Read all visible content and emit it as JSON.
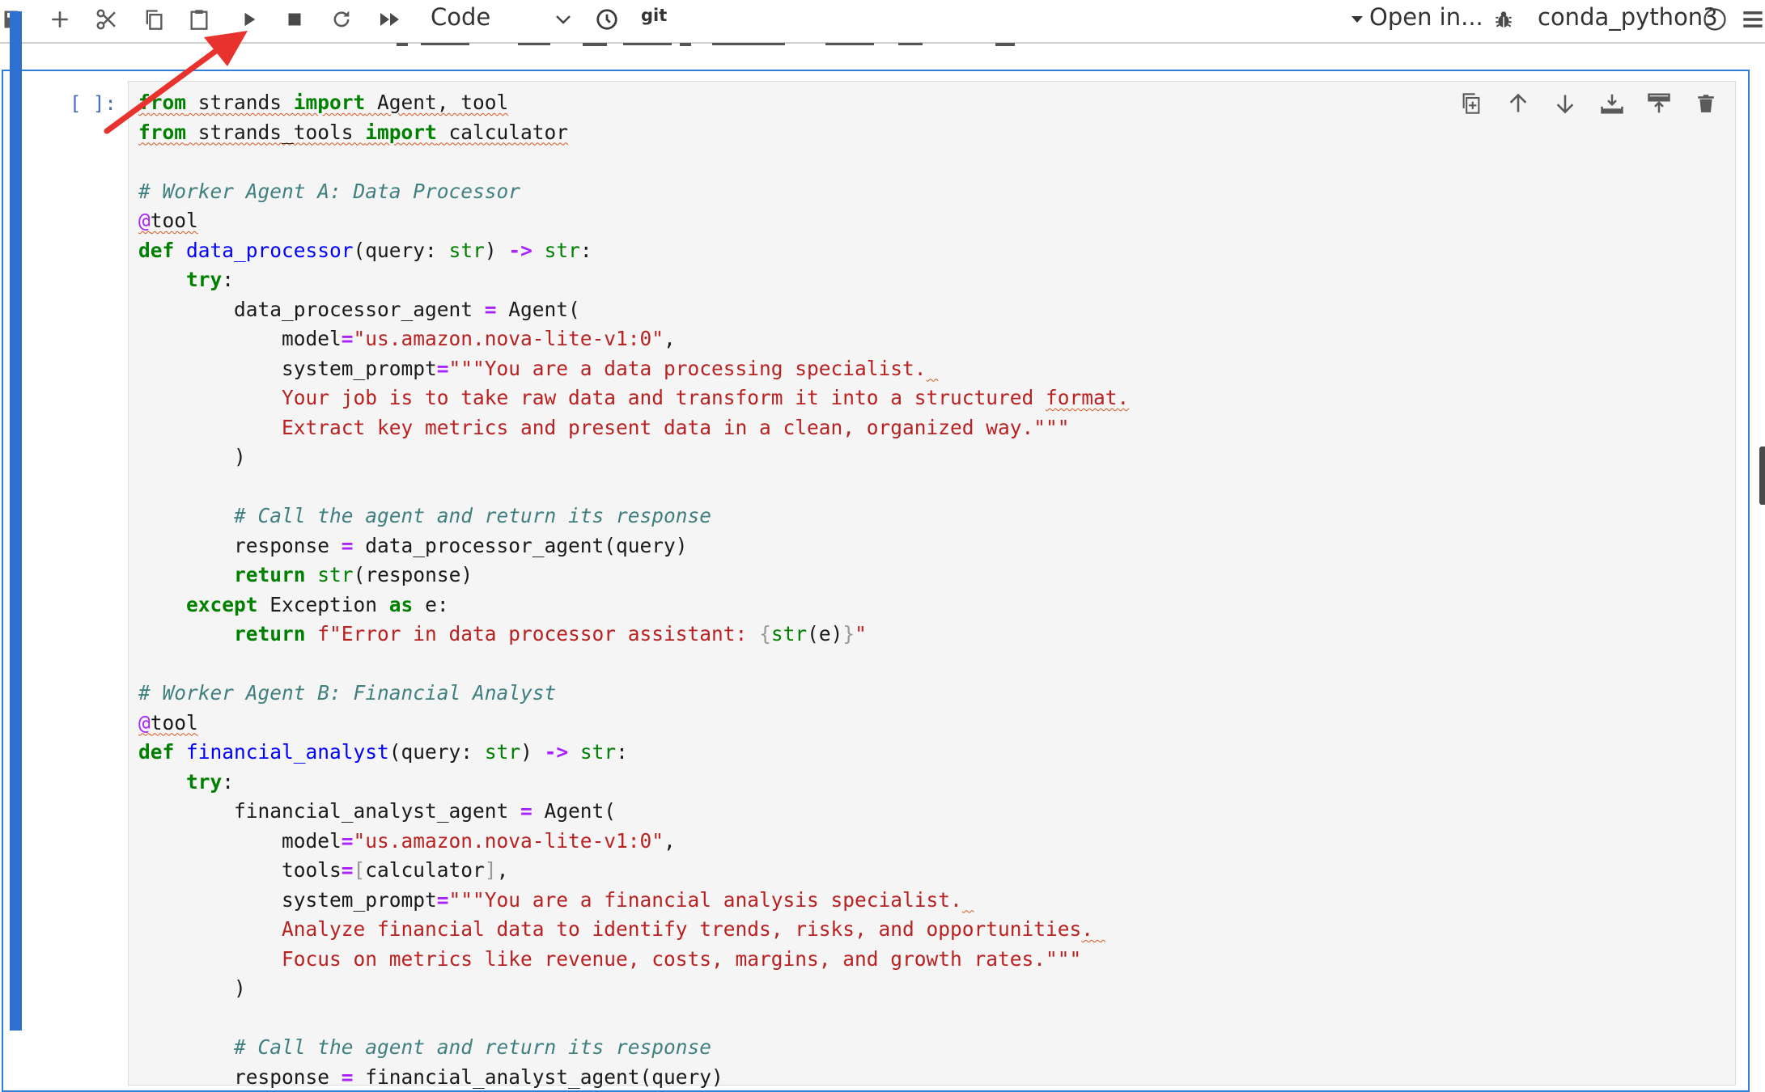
{
  "toolbar": {
    "cell_type": "Code",
    "git": "git",
    "open_in": "Open in...",
    "kernel_name": "conda_python3",
    "buttons": [
      "save-icon",
      "add-icon",
      "cut-icon",
      "copy-icon",
      "paste-icon",
      "run-icon",
      "stop-icon",
      "restart-icon",
      "run-all-icon",
      "history-icon",
      "debug-icon",
      "menu-icon"
    ]
  },
  "cell": {
    "prompt": "[ ]:",
    "actions": [
      "duplicate-icon",
      "move-up-icon",
      "move-down-icon",
      "insert-below-icon",
      "insert-above-icon",
      "delete-icon"
    ]
  },
  "colors": {
    "accent": "#2f7fd8",
    "annotation": "#e8322d",
    "keyword": "#008000",
    "string": "#ba2121",
    "comment": "#408080",
    "function": "#0000ff"
  }
}
